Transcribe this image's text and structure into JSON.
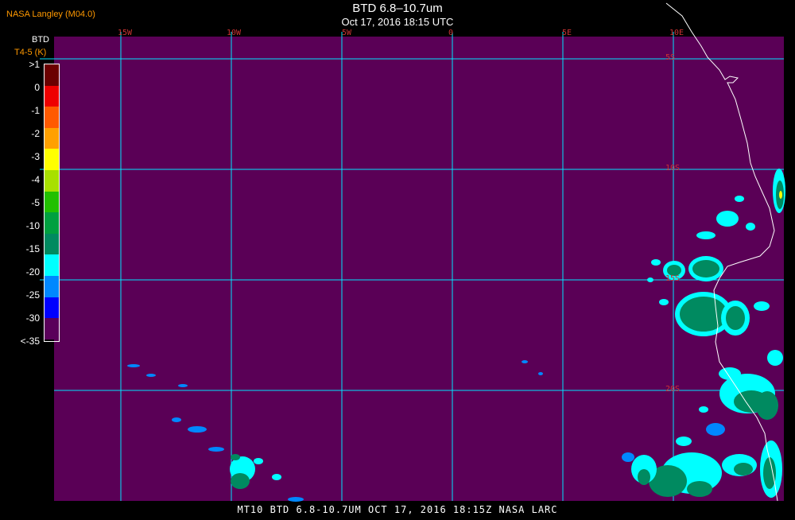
{
  "header": {
    "org_label": "NASA Langley (M04.0)",
    "title": "BTD 6.8–10.7um",
    "subtitle": "Oct 17, 2016 18:15 UTC"
  },
  "legend": {
    "title": "BTD",
    "units": "T4-5 (K)",
    "entries": [
      {
        "label": ">1",
        "color": "#6b0000"
      },
      {
        "label": "0",
        "color": "#ee0000"
      },
      {
        "label": "-1",
        "color": "#ff5a00"
      },
      {
        "label": "-2",
        "color": "#ffa000"
      },
      {
        "label": "-3",
        "color": "#ffff00"
      },
      {
        "label": "-4",
        "color": "#a8e000"
      },
      {
        "label": "-5",
        "color": "#22c000"
      },
      {
        "label": "-10",
        "color": "#00a040"
      },
      {
        "label": "-15",
        "color": "#008a60"
      },
      {
        "label": "-20",
        "color": "#00ffff"
      },
      {
        "label": "-25",
        "color": "#0088ff"
      },
      {
        "label": "-30",
        "color": "#0000ff"
      },
      {
        "label": "<-35",
        "color": "#5a005a"
      }
    ]
  },
  "grid": {
    "longitude_labels": [
      "15W",
      "10W",
      "5W",
      "0",
      "5E",
      "10E"
    ],
    "latitude_labels": [
      "5S",
      "10S",
      "15S",
      "20S"
    ]
  },
  "footer": {
    "text": "MT10  BTD 6.8-10.7UM  OCT 17, 2016 18:15Z  NASA LARC"
  },
  "colors": {
    "background": "#000000",
    "map_field": "#5a0056",
    "gridline": "#00e5ff",
    "coastline": "#ffffff",
    "grid_label": "#cc3333",
    "cloud_light": "#00ffff",
    "cloud_mid": "#0088ff",
    "cloud_dense": "#008a60"
  }
}
